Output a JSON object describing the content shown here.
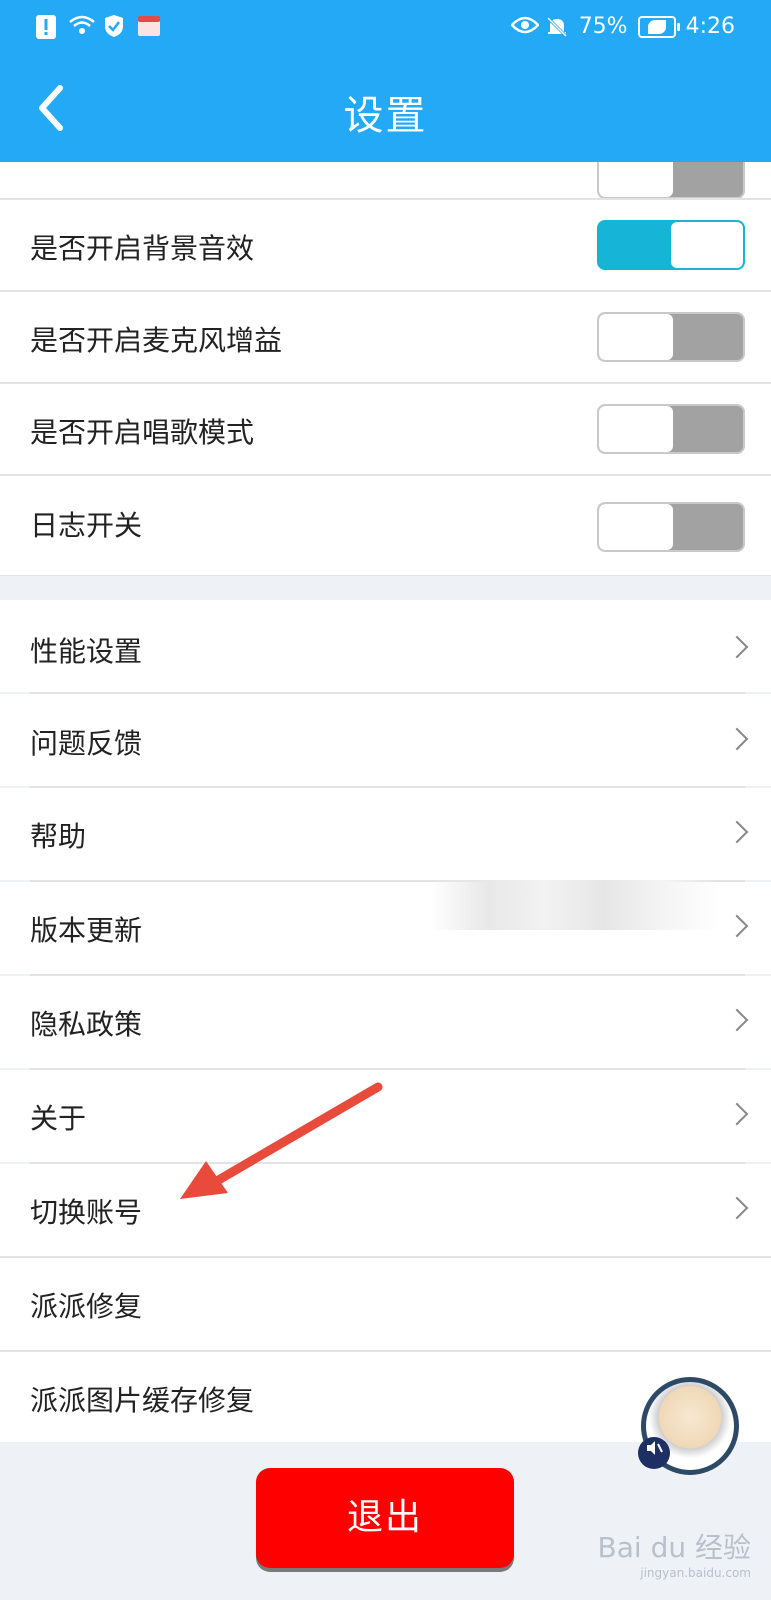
{
  "status_bar": {
    "battery": "75%",
    "time": "4:26"
  },
  "header": {
    "title": "设置"
  },
  "toggles": [
    {
      "label": "是否开启背景音效",
      "on": true
    },
    {
      "label": "是否开启麦克风增益",
      "on": false
    },
    {
      "label": "是否开启唱歌模式",
      "on": false
    },
    {
      "label": "日志开关",
      "on": false
    }
  ],
  "nav_items": [
    {
      "label": "性能设置"
    },
    {
      "label": "问题反馈"
    },
    {
      "label": "帮助"
    },
    {
      "label": "版本更新"
    },
    {
      "label": "隐私政策"
    },
    {
      "label": "关于"
    },
    {
      "label": "切换账号"
    }
  ],
  "plain_items": [
    {
      "label": "派派修复"
    },
    {
      "label": "派派图片缓存修复"
    }
  ],
  "logout_label": "退出",
  "colors": {
    "header": "#23a9f6",
    "toggle_on": "#16b5d8",
    "toggle_off": "#a2a2a2",
    "logout": "#ff0000",
    "arrow": "#e84a3c"
  },
  "watermark": {
    "brand": "Bai du 经验",
    "url": "jingyan.baidu.com"
  }
}
